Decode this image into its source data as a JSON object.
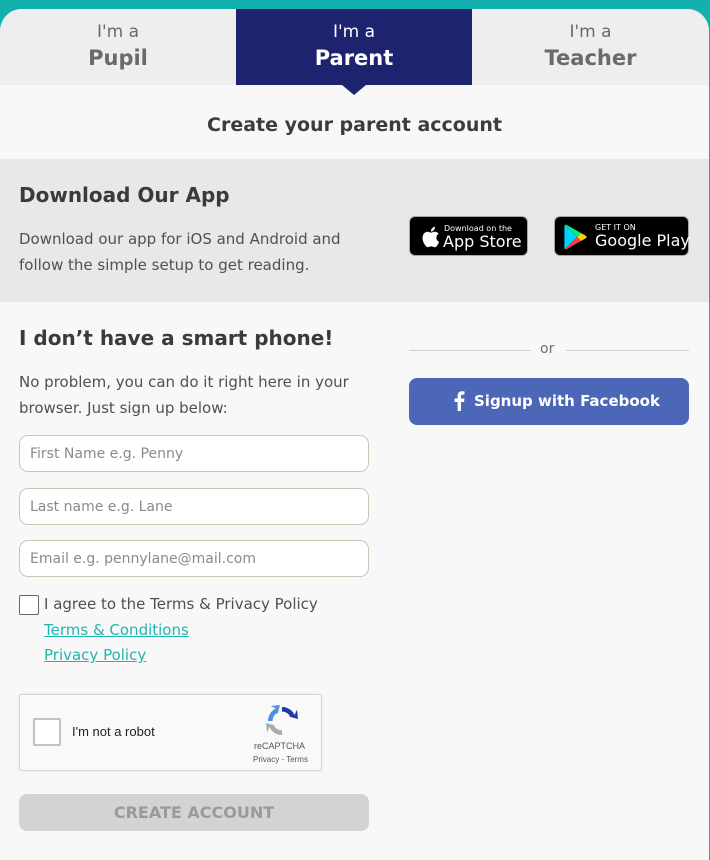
{
  "tabs": [
    {
      "pre": "I'm a",
      "label": "Pupil"
    },
    {
      "pre": "I'm a",
      "label": "Parent"
    },
    {
      "pre": "I'm a",
      "label": "Teacher"
    }
  ],
  "heading": "Create your parent account",
  "download": {
    "title": "Download Our App",
    "text": "Download our app for iOS and Android and follow the simple setup to get reading.",
    "apple_small": "Download on the",
    "apple_big": "App Store",
    "google_small": "GET IT ON",
    "google_big": "Google Play"
  },
  "form": {
    "title": "I don’t have a smart phone!",
    "intro": "No problem, you can do it right here in your browser. Just sign up below:",
    "first_name_placeholder": "First Name e.g. Penny",
    "last_name_placeholder": "Last name e.g. Lane",
    "email_placeholder": "Email e.g. pennylane@mail.com",
    "agree_label": "I agree to the Terms & Privacy Policy",
    "terms_link": "Terms & Conditions",
    "privacy_link": "Privacy Policy",
    "captcha_label": "I'm not a robot",
    "captcha_brand": "reCAPTCHA",
    "captcha_terms": "Privacy - Terms",
    "create_label": "CREATE ACCOUNT"
  },
  "social": {
    "or": "or",
    "facebook_label": "Signup with Facebook"
  },
  "colors": {
    "background": "#14b0ae",
    "active_tab": "#1e2370",
    "facebook": "#4c67b7",
    "link": "#22b6ae"
  }
}
